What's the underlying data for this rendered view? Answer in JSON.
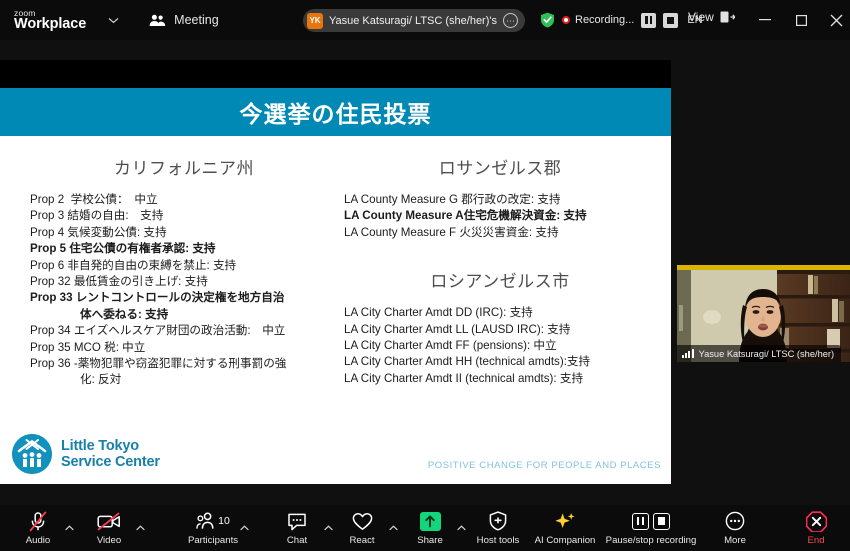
{
  "topbar": {
    "brand_small": "zoom",
    "brand_big": "Workplace",
    "brand_caret": "⌄",
    "meeting_label": "Meeting",
    "meeting_icon": "people-icon",
    "participant_pill": {
      "avatar_initials": "YK",
      "name": "Yasue Katsuragi/ LTSC (she/her)'s",
      "more_icon": "ellipsis-icon"
    },
    "security_icon": "shield-check-icon",
    "recording_label": "Recording...",
    "recording_dot": "record-dot-icon",
    "pause_recording_icon": "pause-icon",
    "stop_recording_icon": "stop-icon",
    "language": "EN",
    "view_label": "View",
    "view_icon": "layout-icon",
    "window_minimize": "–",
    "window_maximize": "□",
    "window_close": "✕",
    "accent_record": "#e02020",
    "accent_shield": "#2fbf55",
    "accent_avatar": "#e8760f"
  },
  "slide": {
    "title": "今選挙の住民投票",
    "banner_color": "#0089b4",
    "columns": {
      "left": {
        "heading": "カリフォルニア州",
        "items": [
          {
            "text": "Prop 2  学校公債：　中立",
            "bold": false,
            "indent": false
          },
          {
            "text": "Prop 3 結婚の自由:　支持",
            "bold": false,
            "indent": false
          },
          {
            "text": "Prop 4 気候変動公債: 支持",
            "bold": false,
            "indent": false
          },
          {
            "text": "Prop 5 住宅公債の有権者承認: 支持",
            "bold": true,
            "indent": false
          },
          {
            "text": "Prop 6 非自発的自由の束縛を禁止: 支持",
            "bold": false,
            "indent": false
          },
          {
            "text": "Prop 32 最低賃金の引き上げ: 支持",
            "bold": false,
            "indent": false
          },
          {
            "text": "Prop 33 レントコントロールの決定権を地方自治",
            "bold": true,
            "indent": false
          },
          {
            "text": "体へ委ねる: 支持",
            "bold": true,
            "indent": true
          },
          {
            "text": "Prop 34 エイズヘルスケア財団の政治活動:　中立",
            "bold": false,
            "indent": false
          },
          {
            "text": "Prop 35 MCO 税: 中立",
            "bold": false,
            "indent": false
          },
          {
            "text": "Prop 36 -薬物犯罪や窃盗犯罪に対する刑事罰の強",
            "bold": false,
            "indent": false
          },
          {
            "text": "化: 反対",
            "bold": false,
            "indent": true
          }
        ]
      },
      "right_county": {
        "heading": "ロサンゼルス郡",
        "items": [
          {
            "text": "LA County Measure G 郡行政の改定: 支持",
            "bold": false
          },
          {
            "text": "LA County Measure A住宅危機解決資金: 支持",
            "bold": true
          },
          {
            "text": "LA County Measure F 火災災害資金: 支持",
            "bold": false
          }
        ]
      },
      "right_city": {
        "heading": "ロシアンゼルス市",
        "items": [
          {
            "text": "LA City Charter Amdt DD (IRC): 支持",
            "bold": false
          },
          {
            "text": "LA City Charter Amdt LL (LAUSD IRC): 支持",
            "bold": false
          },
          {
            "text": "LA City Charter Amdt FF (pensions): 中立",
            "bold": false
          },
          {
            "text": "LA City Charter Amdt HH (technical amdts):支持",
            "bold": false
          },
          {
            "text": "LA City Charter Amdt II (technical amdts): 支持",
            "bold": false
          }
        ]
      }
    },
    "logo": {
      "line1": "Little Tokyo",
      "line2": "Service Center",
      "mark_icon": "ltsc-house-logo-icon",
      "color": "#1880ab"
    },
    "tagline": "POSITIVE CHANGE FOR PEOPLE AND PLACES",
    "tagline_color": "#7fc4dd"
  },
  "video_thumbnail": {
    "name": "Yasue Katsuragi/ LTSC (she/her)",
    "signal_icon": "signal-bars-icon"
  },
  "toolbar": {
    "items": [
      {
        "label": "Audio",
        "icon": "microphone-muted-icon",
        "caret": true,
        "count": null
      },
      {
        "label": "Video",
        "icon": "camera-muted-icon",
        "caret": true,
        "count": null
      },
      {
        "label": "Participants",
        "icon": "participants-icon",
        "caret": true,
        "count": "10"
      },
      {
        "label": "Chat",
        "icon": "chat-bubble-icon",
        "caret": true,
        "count": null
      },
      {
        "label": "React",
        "icon": "heart-icon",
        "caret": true,
        "count": null
      },
      {
        "label": "Share",
        "icon": "share-screen-icon",
        "caret": true,
        "count": null
      },
      {
        "label": "Host tools",
        "icon": "shield-icon",
        "caret": false,
        "count": null
      },
      {
        "label": "AI Companion",
        "icon": "sparkle-icon",
        "caret": false,
        "count": null
      },
      {
        "label": "Pause/stop recording",
        "icon": "pause-stop-recording-icon",
        "caret": false,
        "count": null
      },
      {
        "label": "More",
        "icon": "ellipsis-icon",
        "caret": false,
        "count": null
      },
      {
        "label": "End",
        "icon": "end-call-icon",
        "caret": false,
        "count": null
      }
    ],
    "muted_color": "#ff3b4e",
    "share_color": "#12d67b",
    "ai_color": "#ffd02e",
    "end_color": "#ff4757"
  }
}
